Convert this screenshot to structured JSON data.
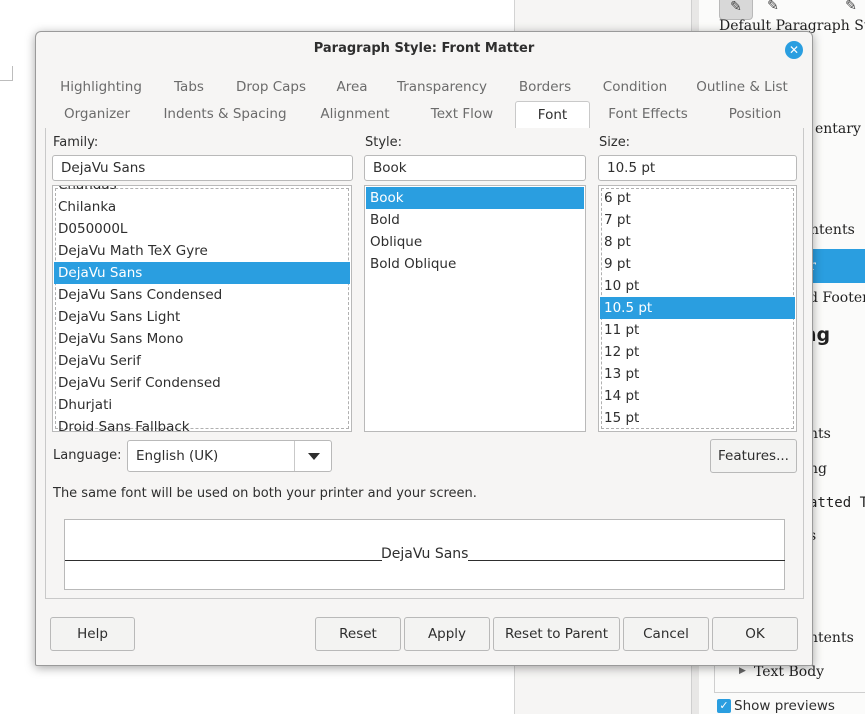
{
  "background": {
    "sidebar_items": [
      "Default Paragraph Style",
      "entary Clo",
      "ntents",
      "er",
      "d Footer",
      "ng",
      "nts",
      "ng",
      "atted T",
      "s",
      "ntents",
      "Text Body"
    ],
    "show_previews": "Show previews"
  },
  "dialog": {
    "title": "Paragraph Style: Front Matter",
    "tabs_row1": [
      "Highlighting",
      "Tabs",
      "Drop Caps",
      "Area",
      "Transparency",
      "Borders",
      "Condition",
      "Outline & List"
    ],
    "tabs_row2": [
      "Organizer",
      "Indents & Spacing",
      "Alignment",
      "Text Flow",
      "Font",
      "Font Effects",
      "Position"
    ],
    "active_tab": "Font",
    "family": {
      "label": "Family:",
      "value": "DejaVu Sans",
      "items": [
        "Chandas",
        "Chilanka",
        "D050000L",
        "DejaVu Math TeX Gyre",
        "DejaVu Sans",
        "DejaVu Sans Condensed",
        "DejaVu Sans Light",
        "DejaVu Sans Mono",
        "DejaVu Serif",
        "DejaVu Serif Condensed",
        "Dhurjati",
        "Droid Sans Fallback"
      ],
      "selected": "DejaVu Sans"
    },
    "style": {
      "label": "Style:",
      "value": "Book",
      "items": [
        "Book",
        "Bold",
        "Oblique",
        "Bold Oblique"
      ],
      "selected": "Book"
    },
    "size": {
      "label": "Size:",
      "value": "10.5 pt",
      "items": [
        "6 pt",
        "7 pt",
        "8 pt",
        "9 pt",
        "10 pt",
        "10.5 pt",
        "11 pt",
        "12 pt",
        "13 pt",
        "14 pt",
        "15 pt"
      ],
      "selected": "10.5 pt"
    },
    "language": {
      "label": "Language:",
      "value": "English (UK)"
    },
    "features_label": "Features...",
    "info_text": "The same font will be used on both your printer and your screen.",
    "preview_text": "DejaVu Sans",
    "buttons": {
      "help": "Help",
      "reset": "Reset",
      "apply": "Apply",
      "reset_to_parent": "Reset to Parent",
      "cancel": "Cancel",
      "ok": "OK"
    }
  },
  "colors": {
    "accent": "#2a9ee0",
    "dialog_bg": "#f6f5f4"
  }
}
